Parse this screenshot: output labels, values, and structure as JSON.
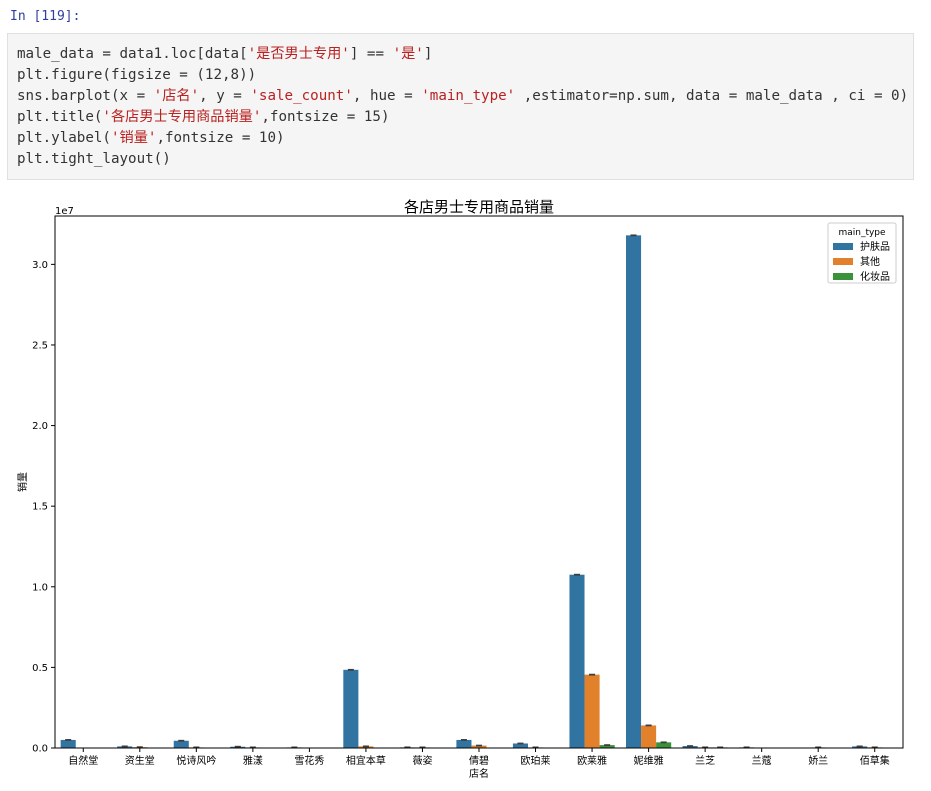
{
  "cell": {
    "prompt": "In [119]:",
    "code_lines": [
      "male_data = data1.loc[data['是否男士专用'] == '是']",
      "plt.figure(figsize = (12,8))",
      "sns.barplot(x = '店名', y = 'sale_count', hue = 'main_type' ,estimator=np.sum, data = male_data , ci = 0)",
      "plt.title('各店男士专用商品销量',fontsize = 15)",
      "plt.ylabel('销量',fontsize = 10)",
      "plt.tight_layout()"
    ]
  },
  "chart_data": {
    "type": "bar",
    "title": "各店男士专用商品销量",
    "xlabel": "店名",
    "ylabel": "销量",
    "offset_label": "1e7",
    "ylim": [
      0,
      3.3
    ],
    "yticks": [
      0.0,
      0.5,
      1.0,
      1.5,
      2.0,
      2.5,
      3.0
    ],
    "ytick_labels": [
      "0.0",
      "0.5",
      "1.0",
      "1.5",
      "2.0",
      "2.5",
      "3.0"
    ],
    "grid": false,
    "legend_title": "main_type",
    "legend_position": "top-right",
    "categories": [
      "自然堂",
      "资生堂",
      "悦诗风吟",
      "雅漾",
      "雪花秀",
      "相宜本草",
      "薇姿",
      "倩碧",
      "欧珀莱",
      "欧莱雅",
      "妮维雅",
      "兰芝",
      "兰蔻",
      "娇兰",
      "佰草集"
    ],
    "series": [
      {
        "name": "护肤品",
        "color": "#3274a1",
        "values": [
          0.05,
          0.01,
          0.045,
          0.008,
          0.003,
          0.485,
          0.004,
          0.05,
          0.028,
          1.075,
          3.18,
          0.012,
          0.004,
          null,
          0.01
        ]
      },
      {
        "name": "其他",
        "color": "#e1812c",
        "values": [
          null,
          0.005,
          0.003,
          0.003,
          null,
          0.01,
          0.003,
          0.015,
          0.003,
          0.455,
          0.14,
          0.004,
          null,
          0.003,
          0.004
        ]
      },
      {
        "name": "化妆品",
        "color": "#3a923a",
        "values": [
          null,
          null,
          null,
          null,
          null,
          null,
          null,
          null,
          null,
          0.018,
          0.035,
          0.002,
          null,
          null,
          null
        ]
      }
    ]
  }
}
